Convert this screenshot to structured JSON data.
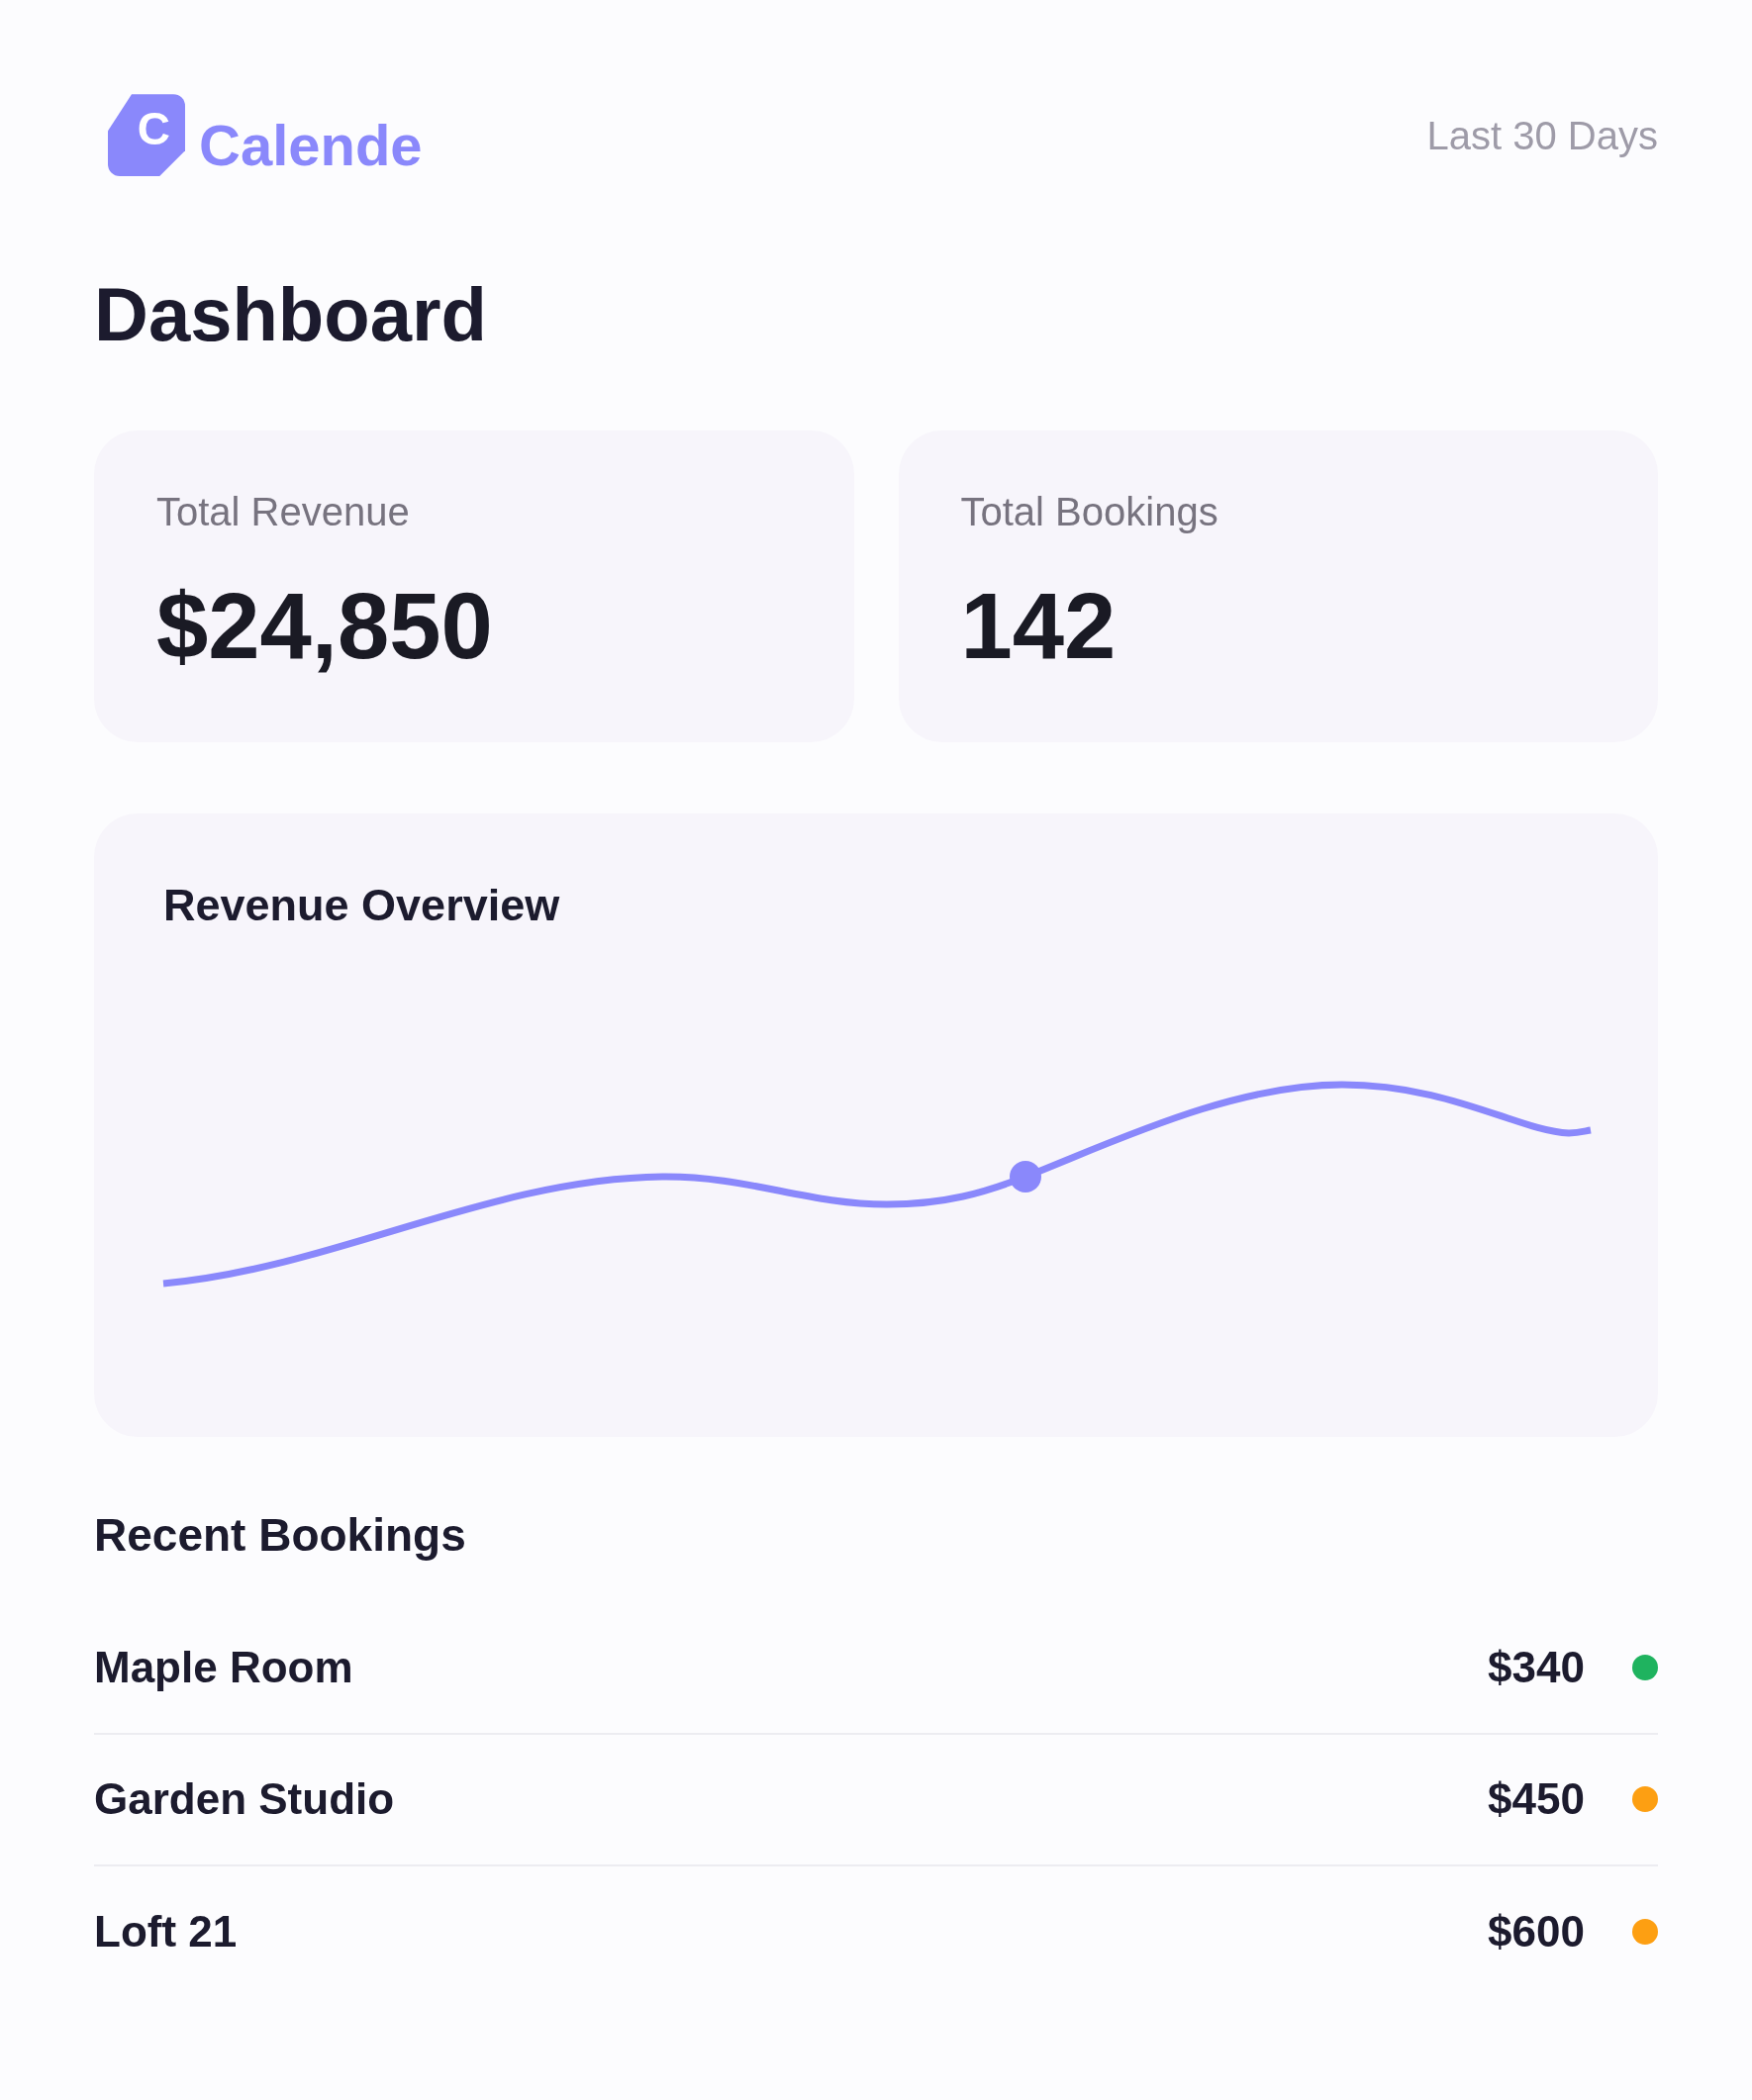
{
  "header": {
    "logo": {
      "mark": "C",
      "name": "Calende"
    },
    "period": "Last 30 Days"
  },
  "page_title": "Dashboard",
  "stats": [
    {
      "label": "Total Revenue",
      "value": "$24,850"
    },
    {
      "label": "Total Bookings",
      "value": "142"
    }
  ],
  "revenue_overview": {
    "title": "Revenue Overview"
  },
  "recent_bookings": {
    "title": "Recent Bookings",
    "rows": [
      {
        "name": "Maple Room",
        "amount": "$340",
        "color": "#1fb35f"
      },
      {
        "name": "Garden Studio",
        "amount": "$450",
        "color": "#fd9f12"
      },
      {
        "name": "Loft 21",
        "amount": "$600",
        "color": "#fd9f12"
      }
    ]
  }
}
